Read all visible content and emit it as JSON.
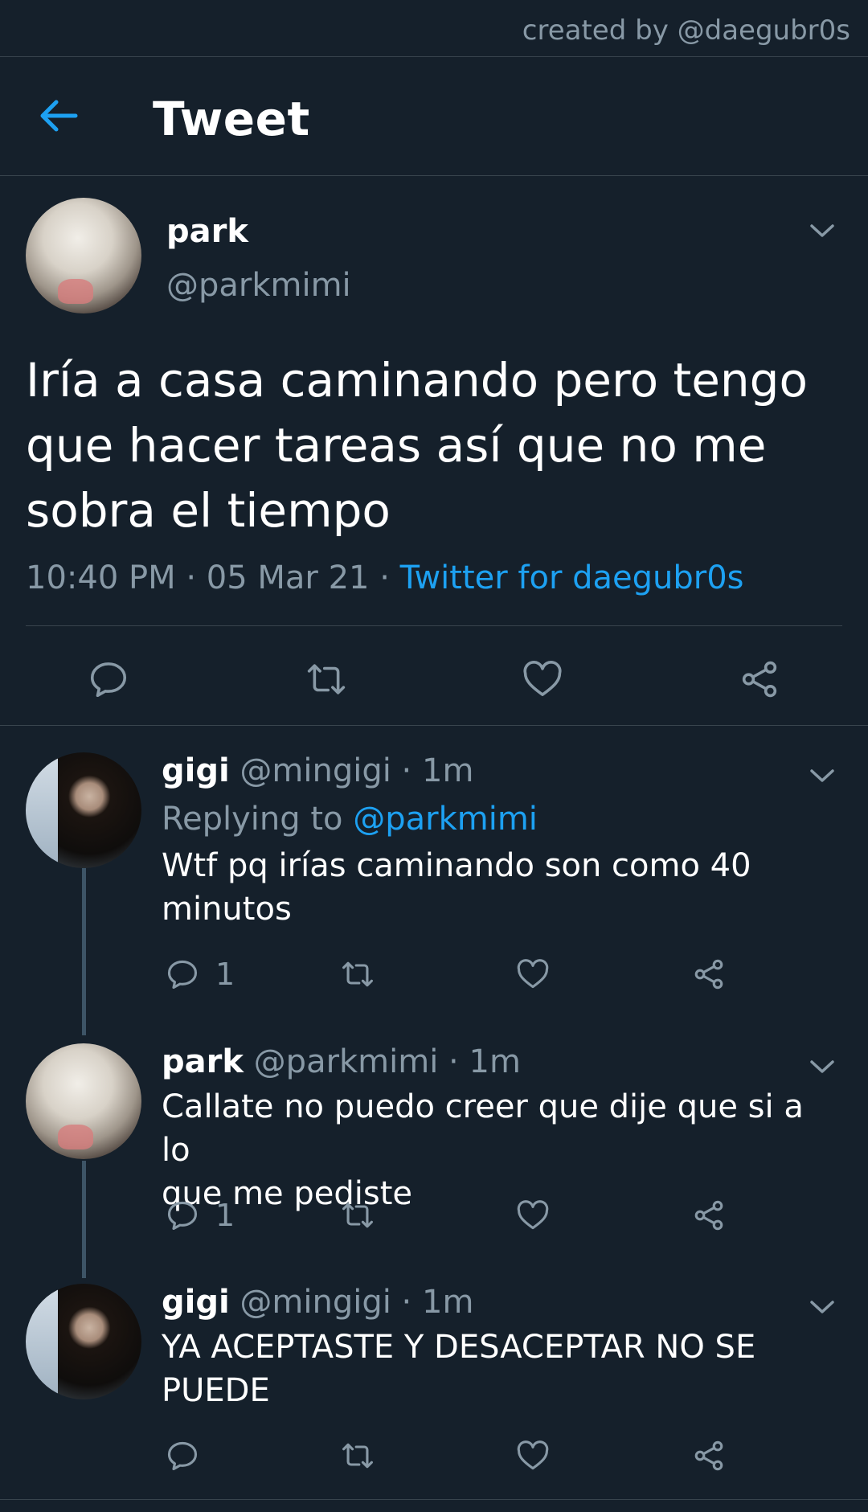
{
  "credit": "created by @daegubr0s",
  "header": {
    "title": "Tweet",
    "back_icon": "arrow-left-icon",
    "accent": "#1da1f2"
  },
  "main_tweet": {
    "name": "park",
    "handle": "@parkmimi",
    "text_lines": [
      "Iría a casa caminando pero tengo",
      "que hacer tareas así que no me",
      "sobra el tiempo"
    ],
    "time": "10:40 PM",
    "sep1": " · ",
    "date": "05 Mar 21",
    "sep2": " · ",
    "source": "Twitter for daegubr0s"
  },
  "replies": [
    {
      "name": "gigi",
      "handle": "@mingigi",
      "sep": " · ",
      "time": "1m",
      "replying_prefix": "Replying to ",
      "replying_to": "@parkmimi",
      "text_lines": [
        "Wtf pq irías caminando son como 40",
        "minutos"
      ],
      "reply_count": "1"
    },
    {
      "name": "park",
      "handle": "@parkmimi",
      "sep": " · ",
      "time": "1m",
      "text_lines": [
        "Callate no puedo creer que dije que si a lo",
        "que me pediste"
      ],
      "reply_count": "1"
    },
    {
      "name": "gigi",
      "handle": "@mingigi",
      "sep": " · ",
      "time": "1m",
      "text_lines": [
        "YA ACEPTASTE Y DESACEPTAR NO SE",
        "PUEDE"
      ],
      "reply_count": ""
    }
  ],
  "colors": {
    "background": "#15202b",
    "muted": "#8899a6",
    "link": "#1da1f2",
    "divider": "#38444d"
  }
}
